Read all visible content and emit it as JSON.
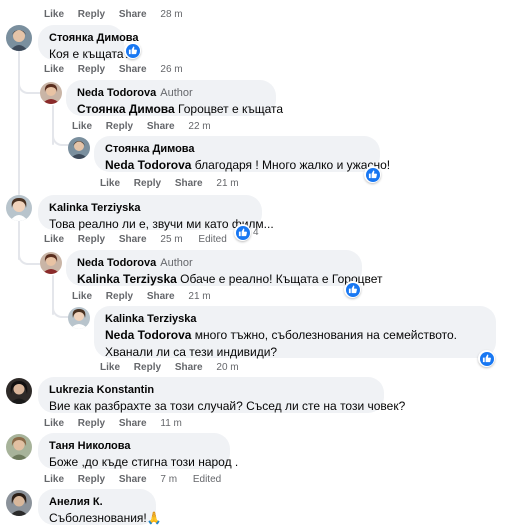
{
  "actions": {
    "like": "Like",
    "reply": "Reply",
    "share": "Share",
    "edited": "Edited"
  },
  "author_badge": "Author",
  "emoji": {
    "pray": "🙏"
  },
  "colors": {
    "bubble_bg": "#f0f2f5",
    "like_blue": "#1877f2",
    "meta_gray": "#65676b",
    "thread_line": "#e4e6eb"
  },
  "comments": [
    {
      "time": "28 m"
    },
    {
      "name": "Стоянка Димова",
      "text": "Коя е къщата?",
      "time": "26 m",
      "reaction": "like"
    },
    {
      "name": "Neda Todorova",
      "author": true,
      "mention": "Стоянка Димова",
      "text": " Гороцвет е къщата",
      "time": "22 m"
    },
    {
      "name": "Стоянка Димова",
      "mention": "Neda Todorova",
      "text": " благодаря ! Много жалко и ужасно!",
      "time": "21 m",
      "reaction": "like"
    },
    {
      "name": "Kalinka Terziyska",
      "text": "Това реално ли е, звучи ми като филм...",
      "time": "25 m",
      "edited": true,
      "reaction": "like",
      "reaction_count": "4"
    },
    {
      "name": "Neda Todorova",
      "author": true,
      "mention": "Kalinka Terziyska",
      "text": " Обаче е реално! Къщата е Гороцвет",
      "time": "21 m",
      "reaction": "like"
    },
    {
      "name": "Kalinka Terziyska",
      "mention": "Neda Todorova",
      "text": " много тъжно, съболезнования на семейството. Хванали ли са тези индивиди?",
      "time": "20 m",
      "reaction": "like"
    },
    {
      "name": "Lukrezia Konstantin",
      "text": "Вие как разбрахте за този случай? Съсед ли сте на този човек?",
      "time": "11 m"
    },
    {
      "name": "Таня Николова",
      "text": "Боже ,до къде стигна този народ .",
      "time": "7 m",
      "edited": true
    },
    {
      "name": "Анелия К.",
      "text": "Съболезнования!"
    }
  ]
}
